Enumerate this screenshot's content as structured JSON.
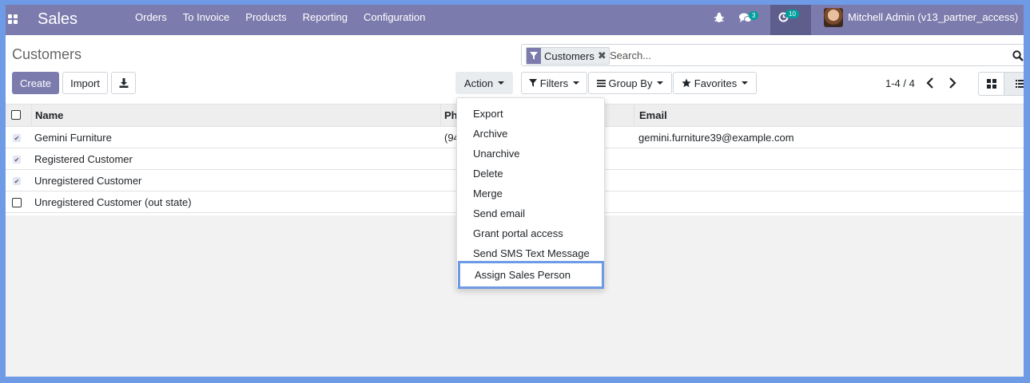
{
  "navbar": {
    "app_name": "Sales",
    "menu": [
      "Orders",
      "To Invoice",
      "Products",
      "Reporting",
      "Configuration"
    ],
    "messages_count": "3",
    "activities_count": "10",
    "user_name": "Mitchell Admin (v13_partner_access)"
  },
  "page": {
    "title": "Customers"
  },
  "buttons": {
    "create": "Create",
    "import": "Import",
    "action": "Action"
  },
  "search": {
    "facet": "Customers",
    "placeholder": "Search..."
  },
  "filters": {
    "filters": "Filters",
    "group_by": "Group By",
    "favorites": "Favorites"
  },
  "pager": {
    "value": "1-4 / 4"
  },
  "table": {
    "headers": {
      "name": "Name",
      "phone": "Ph",
      "email": "Email"
    },
    "rows": [
      {
        "name": "Gemini Furniture",
        "phone": "(94",
        "email": "gemini.furniture39@example.com",
        "checked": true
      },
      {
        "name": "Registered Customer",
        "phone": "",
        "email": "",
        "checked": true
      },
      {
        "name": "Unregistered Customer",
        "phone": "",
        "email": "",
        "checked": true
      },
      {
        "name": "Unregistered Customer (out state)",
        "phone": "",
        "email": "",
        "checked": false
      }
    ]
  },
  "action_menu": {
    "items": [
      "Export",
      "Archive",
      "Unarchive",
      "Delete",
      "Merge",
      "Send email",
      "Grant portal access",
      "Send SMS Text Message",
      "Assign Sales Person"
    ],
    "highlighted": "Assign Sales Person"
  },
  "colors": {
    "navbar": "#7c7bad",
    "primary": "#7c7bad",
    "badge": "#00a09d",
    "highlight": "#6f9be6"
  }
}
